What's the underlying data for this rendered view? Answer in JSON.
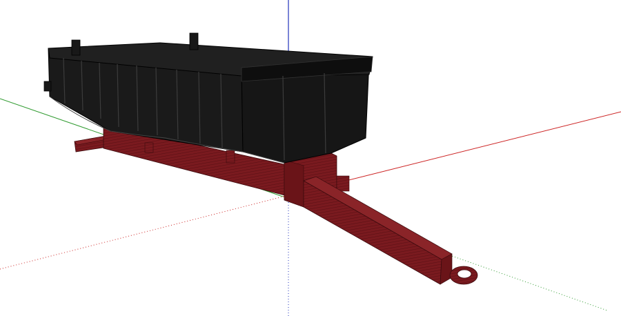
{
  "viewport": {
    "background": "#ffffff"
  },
  "axes": {
    "red_axis_color": "#cc2222",
    "green_axis_color": "#2e9a2e",
    "blue_axis_color": "#2233bb"
  },
  "model": {
    "bin_color": "#161616",
    "bin_edge_color": "#000000",
    "chassis_color": "#7a1a1f",
    "chassis_hatch_color": "#5a0f14"
  }
}
